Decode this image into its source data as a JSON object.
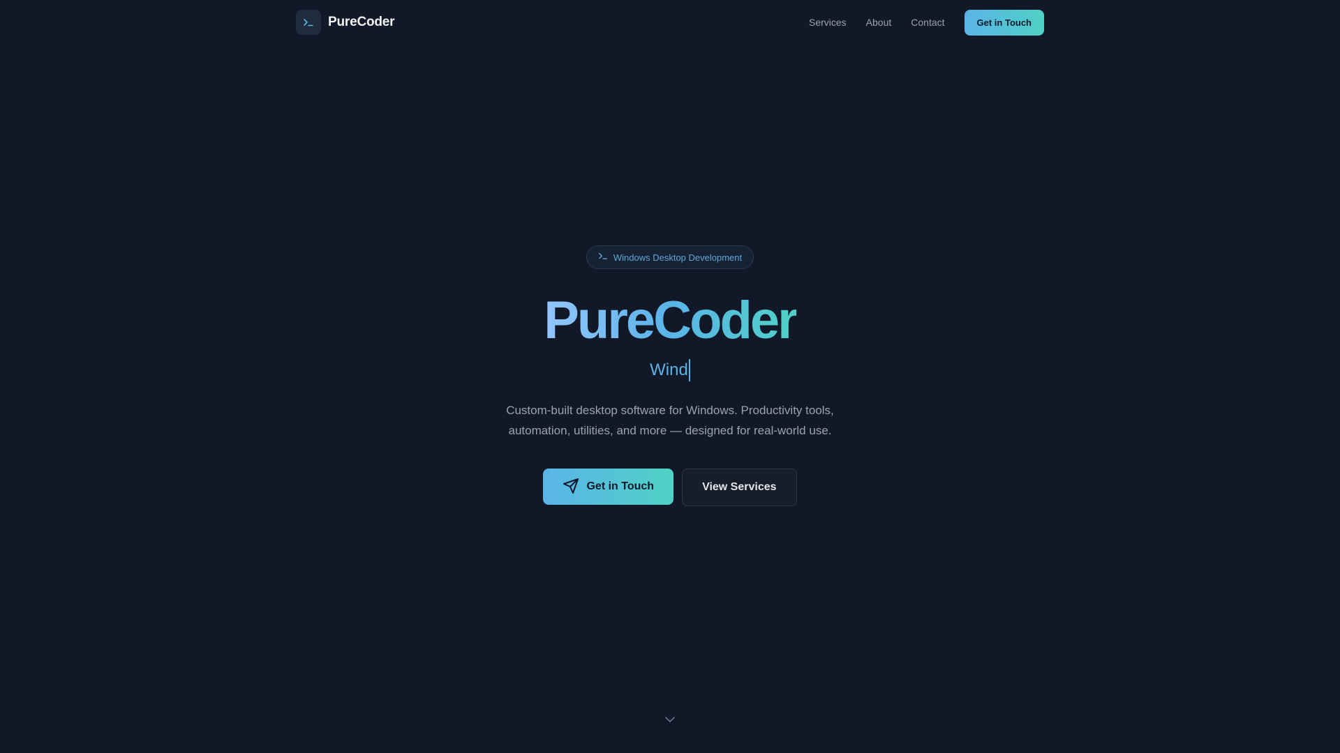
{
  "header": {
    "brand_name": "PureCoder",
    "nav": {
      "services": "Services",
      "about": "About",
      "contact": "Contact"
    },
    "cta_label": "Get in Touch"
  },
  "hero": {
    "badge": "Windows Desktop Development",
    "title": "PureCoder",
    "typing_text": "Wind",
    "description": "Custom-built desktop software for Windows. Productivity tools, automation, utilities, and more — designed for real-world use.",
    "primary_button": "Get in Touch",
    "secondary_button": "View Services"
  },
  "icons": {
    "logo": "terminal-icon",
    "badge": "terminal-icon",
    "primary_button": "send-icon",
    "scroll": "chevron-down-icon"
  },
  "colors": {
    "background": "#111827",
    "accent_start": "#5ab4e8",
    "accent_end": "#4fd1c5",
    "muted_text": "#9ca3af"
  }
}
